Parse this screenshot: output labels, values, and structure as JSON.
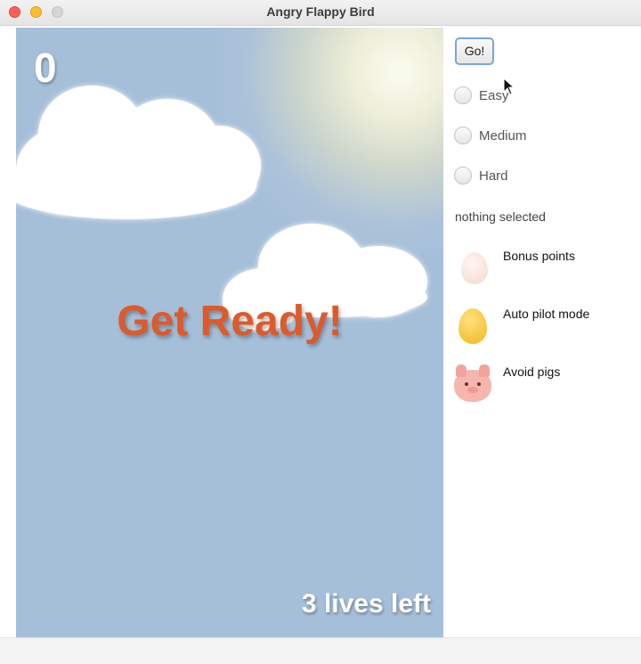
{
  "window": {
    "title": "Angry Flappy Bird"
  },
  "game": {
    "score": "0",
    "message": "Get Ready!",
    "lives_text": "3 lives left",
    "colors": {
      "sky": "#a6bfd9",
      "message": "#dd5a2b",
      "hud_text": "#ffffff"
    }
  },
  "controls": {
    "go_label": "Go!",
    "difficulty_options": [
      {
        "label": "Easy",
        "selected": false
      },
      {
        "label": "Medium",
        "selected": false
      },
      {
        "label": "Hard",
        "selected": false
      }
    ],
    "status": "nothing selected"
  },
  "legend": [
    {
      "icon": "pink-egg-icon",
      "label": "Bonus points"
    },
    {
      "icon": "golden-egg-icon",
      "label": "Auto pilot mode"
    },
    {
      "icon": "pig-icon",
      "label": "Avoid pigs"
    }
  ]
}
